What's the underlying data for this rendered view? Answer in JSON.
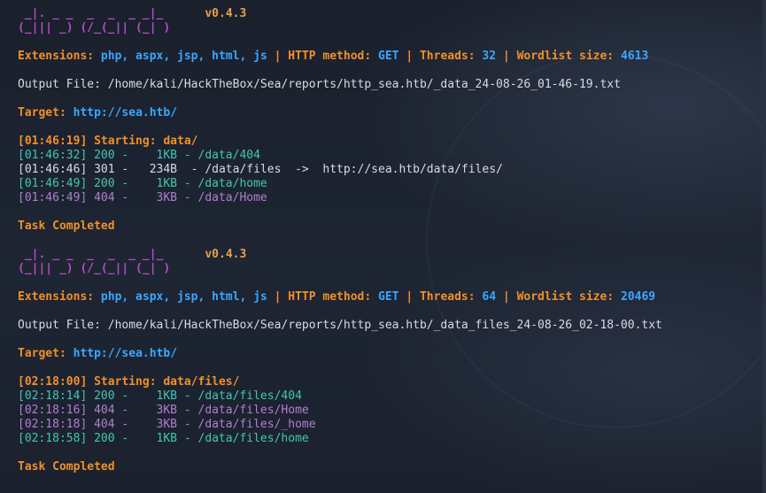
{
  "runs": [
    {
      "banner_line1": " _|. _ _  _  _  _ _|_",
      "banner_line2": "(_||| _) (/_(_|| (_| )",
      "version": "v0.4.3",
      "ext_label": "Extensions:",
      "ext_value": "php, aspx, jsp, html, js",
      "method_label": "HTTP method:",
      "method_value": "GET",
      "threads_label": "Threads:",
      "threads_value": "32",
      "wordlist_label": "Wordlist size:",
      "wordlist_value": "4613",
      "output_line": "Output File: /home/kali/HackTheBox/Sea/reports/http_sea.htb/_data_24-08-26_01-46-19.txt",
      "target_label": "Target:",
      "target_value": "http://sea.htb/",
      "start_line": "[01:46:19] Starting: data/",
      "results": [
        {
          "text": "[01:46:32] 200 -    1KB - /data/404",
          "status": "200"
        },
        {
          "text": "[01:46:46] 301 -   234B  - /data/files  ->  http://sea.htb/data/files/",
          "status": "301"
        },
        {
          "text": "[01:46:49] 200 -    1KB - /data/home",
          "status": "200"
        },
        {
          "text": "[01:46:49] 404 -    3KB - /data/Home",
          "status": "404"
        }
      ],
      "task_done": "Task Completed"
    },
    {
      "banner_line1": " _|. _ _  _  _  _ _|_",
      "banner_line2": "(_||| _) (/_(_|| (_| )",
      "version": "v0.4.3",
      "ext_label": "Extensions:",
      "ext_value": "php, aspx, jsp, html, js",
      "method_label": "HTTP method:",
      "method_value": "GET",
      "threads_label": "Threads:",
      "threads_value": "64",
      "wordlist_label": "Wordlist size:",
      "wordlist_value": "20469",
      "output_line": "Output File: /home/kali/HackTheBox/Sea/reports/http_sea.htb/_data_files_24-08-26_02-18-00.txt",
      "target_label": "Target:",
      "target_value": "http://sea.htb/",
      "start_line": "[02:18:00] Starting: data/files/",
      "results": [
        {
          "text": "[02:18:14] 200 -    1KB - /data/files/404",
          "status": "200"
        },
        {
          "text": "[02:18:16] 404 -    3KB - /data/files/Home",
          "status": "404"
        },
        {
          "text": "[02:18:18] 404 -    3KB - /data/files/_home",
          "status": "404"
        },
        {
          "text": "[02:18:58] 200 -    1KB - /data/files/home",
          "status": "200"
        }
      ],
      "task_done": "Task Completed"
    }
  ],
  "colors": {
    "background": "#1d2330",
    "banner": "#b54ec5",
    "label_orange": "#f0902a",
    "value_blue": "#3aa7ff",
    "status_200": "#41c7b4",
    "status_404": "#b07fd0"
  }
}
